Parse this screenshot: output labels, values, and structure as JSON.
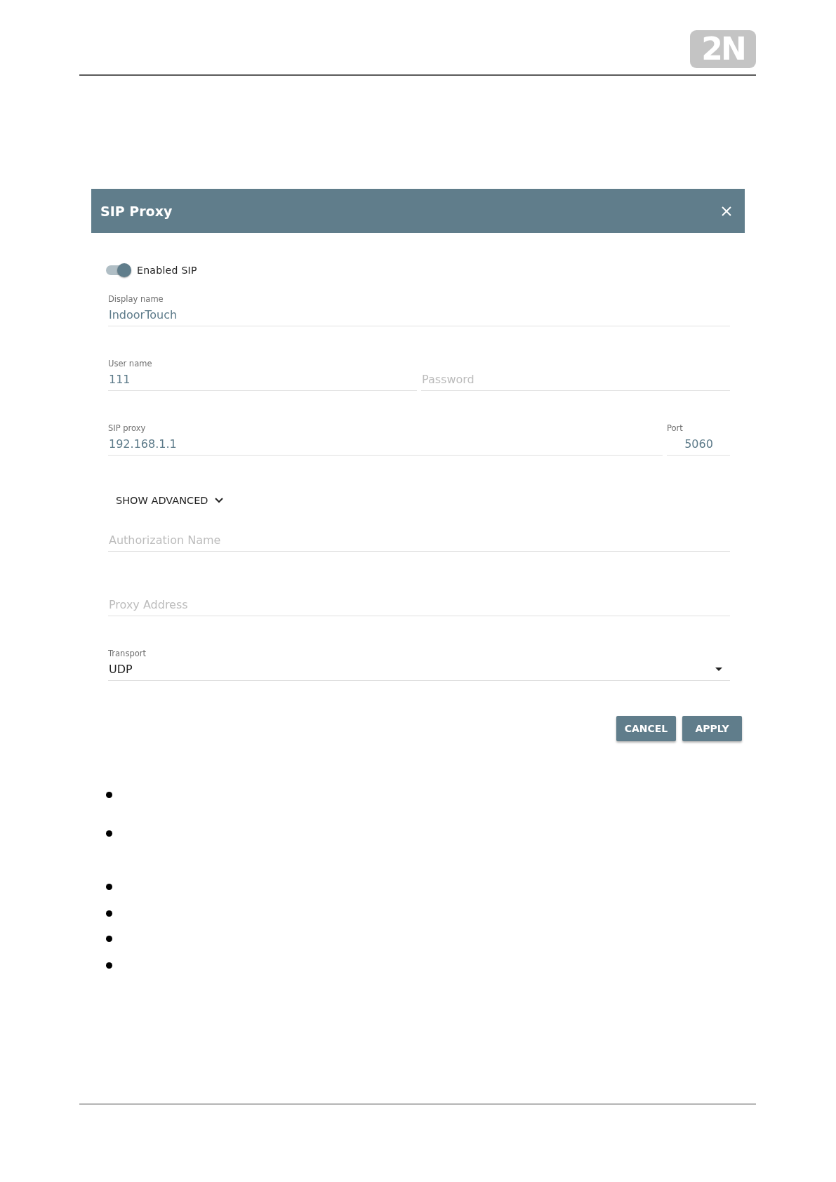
{
  "header": {
    "logo": "2N"
  },
  "dialog": {
    "title": "SIP Proxy",
    "toggle": {
      "label": "Enabled SIP",
      "on": true
    },
    "rows": [
      [
        {
          "kind": "text",
          "label": "Display name",
          "value": "IndoorTouch"
        }
      ],
      [
        {
          "kind": "text",
          "label": "User name",
          "value": "111"
        },
        {
          "kind": "password",
          "placeholder": "Password"
        }
      ],
      [
        {
          "kind": "text",
          "label": "SIP proxy",
          "value": "192.168.1.1"
        },
        {
          "kind": "port",
          "label": "Port",
          "value": "5060"
        }
      ]
    ],
    "advanced_button": {
      "label": "SHOW ADVANCED"
    },
    "advanced_rows": [
      [
        {
          "kind": "text",
          "placeholder": "Authorization Name"
        }
      ],
      [
        {
          "kind": "text",
          "placeholder": "Proxy Address"
        }
      ],
      [
        {
          "kind": "select",
          "label": "Transport",
          "value": "UDP"
        }
      ]
    ],
    "buttons": [
      {
        "label": "CANCEL"
      },
      {
        "label": "APPLY"
      }
    ]
  },
  "bullets": [
    {
      "kind": "dot"
    },
    {
      "kind": "dot"
    },
    {
      "kind": "dot"
    },
    {
      "kind": "dot"
    },
    {
      "kind": "dot"
    },
    {
      "kind": "dot"
    }
  ]
}
